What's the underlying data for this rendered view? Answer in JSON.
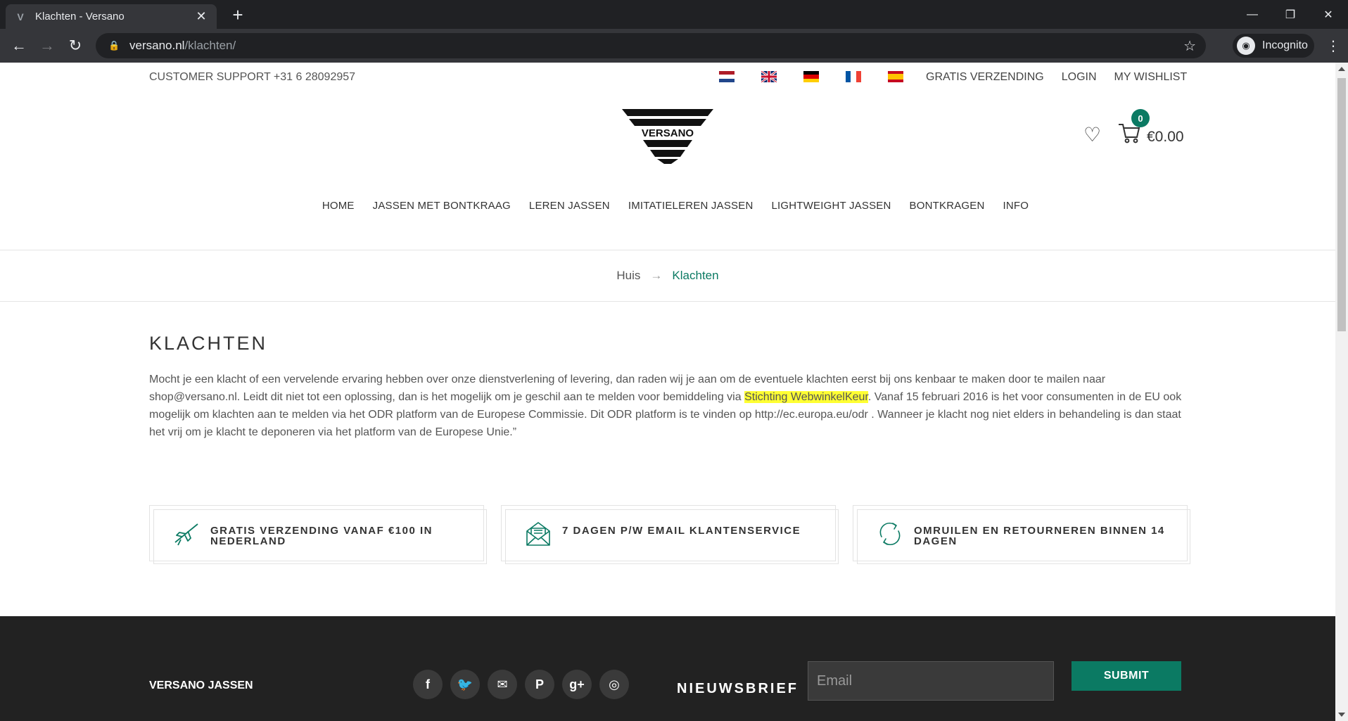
{
  "browser": {
    "tab_title": "Klachten - Versano",
    "tab_favicon": "V",
    "url_domain": "versano.nl",
    "url_path": "/klachten/",
    "profile_label": "Incognito"
  },
  "topbar": {
    "support": "CUSTOMER SUPPORT +31 6 28092957",
    "flags": [
      {
        "name": "nl-flag",
        "colors": [
          "#ae1c28",
          "#ffffff",
          "#21468b"
        ]
      },
      {
        "name": "uk-flag",
        "colors": [
          "#012169",
          "#ffffff",
          "#c8102e"
        ]
      },
      {
        "name": "de-flag",
        "colors": [
          "#000000",
          "#dd0000",
          "#ffce00"
        ]
      },
      {
        "name": "fr-flag",
        "colors": [
          "#0055a4",
          "#ffffff",
          "#ef4135"
        ]
      },
      {
        "name": "es-flag",
        "colors": [
          "#c60b1e",
          "#ffc400",
          "#c60b1e"
        ]
      }
    ],
    "links": [
      "GRATIS VERZENDING",
      "LOGIN",
      "MY WISHLIST"
    ]
  },
  "header": {
    "logo_text": "VERSANO",
    "cart_count": "0",
    "cart_total": "€0.00"
  },
  "nav": [
    "HOME",
    "JASSEN MET BONTKRAAG",
    "LEREN JASSEN",
    "IMITATIELEREN JASSEN",
    "LIGHTWEIGHT JASSEN",
    "BONTKRAGEN",
    "INFO"
  ],
  "breadcrumb": {
    "home": "Huis",
    "separator": "→",
    "current": "Klachten"
  },
  "content": {
    "title": "KLACHTEN",
    "text_before": "Mocht je een klacht of een vervelende ervaring hebben over onze dienstverlening of levering, dan raden wij je aan om de eventuele klachten eerst bij ons kenbaar te maken door te mailen naar shop@versano.nl. Leidt dit niet tot een oplossing, dan is het mogelijk om je geschil aan te melden voor bemiddeling via ",
    "highlight": "Stichting WebwinkelKeur",
    "text_after": ". Vanaf 15 februari 2016 is het voor consumenten in de EU ook mogelijk om klachten aan te melden via het ODR platform van de Europese Commissie. Dit ODR platform is te vinden op http://ec.europa.eu/odr . Wanneer je klacht nog niet elders in behandeling is dan staat het vrij om je klacht te deponeren via het platform van de Europese Unie.”"
  },
  "features": [
    {
      "icon": "airplane-icon",
      "text": "GRATIS VERZENDING VANAF €100 IN NEDERLAND"
    },
    {
      "icon": "envelope-icon",
      "text": "7 DAGEN P/W EMAIL KLANTENSERVICE"
    },
    {
      "icon": "refresh-icon",
      "text": "OMRUILEN EN RETOURNEREN BINNEN 14 DAGEN"
    }
  ],
  "footer": {
    "brand": "VERSANO JASSEN",
    "social": [
      {
        "name": "facebook-icon",
        "glyph": "f"
      },
      {
        "name": "twitter-icon",
        "glyph": "🐦"
      },
      {
        "name": "mail-icon",
        "glyph": "✉"
      },
      {
        "name": "pinterest-icon",
        "glyph": "P"
      },
      {
        "name": "google-plus-icon",
        "glyph": "g+"
      },
      {
        "name": "instagram-icon",
        "glyph": "◎"
      }
    ],
    "newsletter_label": "NIEUWSBRIEF",
    "email_placeholder": "Email",
    "submit_label": "SUBMIT"
  },
  "colors": {
    "accent": "#0b7a63",
    "highlight": "#ffff33",
    "footer_bg": "#222222"
  }
}
